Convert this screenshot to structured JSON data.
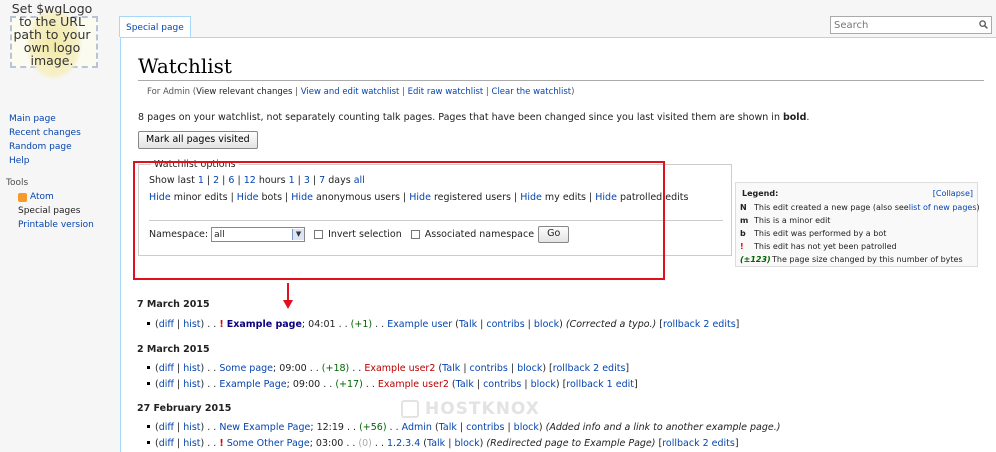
{
  "logo": {
    "lines": [
      "Set $wgLogo",
      "to the URL",
      "path to your",
      "own logo",
      "image."
    ]
  },
  "tab": {
    "label": "Special page"
  },
  "search": {
    "placeholder": "Search",
    "icon": "search-icon"
  },
  "sidebar": {
    "nav": [
      "Main page",
      "Recent changes",
      "Random page",
      "Help"
    ],
    "tools_heading": "Tools",
    "tools": [
      {
        "label": "Atom",
        "icon": "atom-feed-icon"
      },
      {
        "label": "Special pages"
      },
      {
        "label": "Printable version"
      }
    ]
  },
  "page": {
    "title": "Watchlist",
    "sub_prefix": "For Admin (",
    "sub_links": [
      "View relevant changes",
      "View and edit watchlist",
      "Edit raw watchlist",
      "Clear the watchlist"
    ],
    "sub_suffix": ")",
    "intro": "8 pages on your watchlist, not separately counting talk pages. Pages that have been changed since you last visited them are shown in ",
    "intro_bold": "bold",
    "intro_end": ".",
    "mark_button": "Mark all pages visited"
  },
  "options": {
    "legend": "Watchlist options",
    "show_last_prefix": "Show last ",
    "hours": [
      "1",
      "2",
      "6",
      "12"
    ],
    "hours_word": "hours",
    "days": [
      "1",
      "3",
      "7"
    ],
    "days_word": "days",
    "all": "all",
    "hide_word": "Hide",
    "hide_items": [
      "minor edits",
      "bots",
      "anonymous users",
      "registered users",
      "my edits",
      "patrolled edits"
    ],
    "namespace_label": "Namespace:",
    "namespace_value": "all",
    "invert_label": "Invert selection",
    "associated_label": "Associated namespace",
    "go_button": "Go"
  },
  "legend": {
    "title": "Legend:",
    "collapse": "[Collapse]",
    "rows": [
      {
        "key": "N",
        "text": "This edit created a new page (also see ",
        "link": "list of new pages",
        "end": ")"
      },
      {
        "key": "m",
        "text": "This is a minor edit"
      },
      {
        "key": "b",
        "text": "This edit was performed by a bot"
      },
      {
        "key": "!",
        "text": "This edit has not yet been patrolled"
      },
      {
        "key": "(±123)",
        "text": "The page size changed by this number of bytes"
      }
    ]
  },
  "dates": [
    "7 March 2015",
    "2 March 2015",
    "27 February 2015"
  ],
  "changes": [
    {
      "flag": "!",
      "page": "Example page",
      "time": "04:01",
      "size": "(+1)",
      "user": "Example user",
      "comment": "(Corrected a typo.)",
      "rollback": "rollback 2 edits",
      "bold": true
    },
    {
      "flag": "",
      "page": "Some page",
      "time": "09:00",
      "size": "(+18)",
      "user": "Example user2",
      "comment": "",
      "rollback": "rollback 2 edits",
      "bold": false
    },
    {
      "flag": "",
      "page": "Example Page",
      "time": "09:00",
      "size": "(+17)",
      "user": "Example user2",
      "comment": "",
      "rollback": "rollback 1 edit",
      "bold": false
    },
    {
      "flag": "",
      "page": "New Example Page",
      "time": "12:19",
      "size": "(+56)",
      "user": "Admin",
      "comment": "(Added info and a link to another example page.)",
      "rollback": "",
      "bold": false
    },
    {
      "flag": "!",
      "page": "Some Other Page",
      "time": "03:00",
      "size": "(0)",
      "user": "1.2.3.4",
      "comment": "(Redirected page to Example Page)",
      "rollback": "rollback 2 edits",
      "bold": false
    }
  ],
  "row_labels": {
    "diff": "diff",
    "hist": "hist",
    "talk": "Talk",
    "contribs": "contribs",
    "block": "block"
  },
  "watermark": "HOSTKNOX",
  "colors": {
    "annotation_red": "#e20f1c",
    "link_blue": "#0645ad",
    "size_green": "#006400",
    "user_red": "#ba0000"
  }
}
